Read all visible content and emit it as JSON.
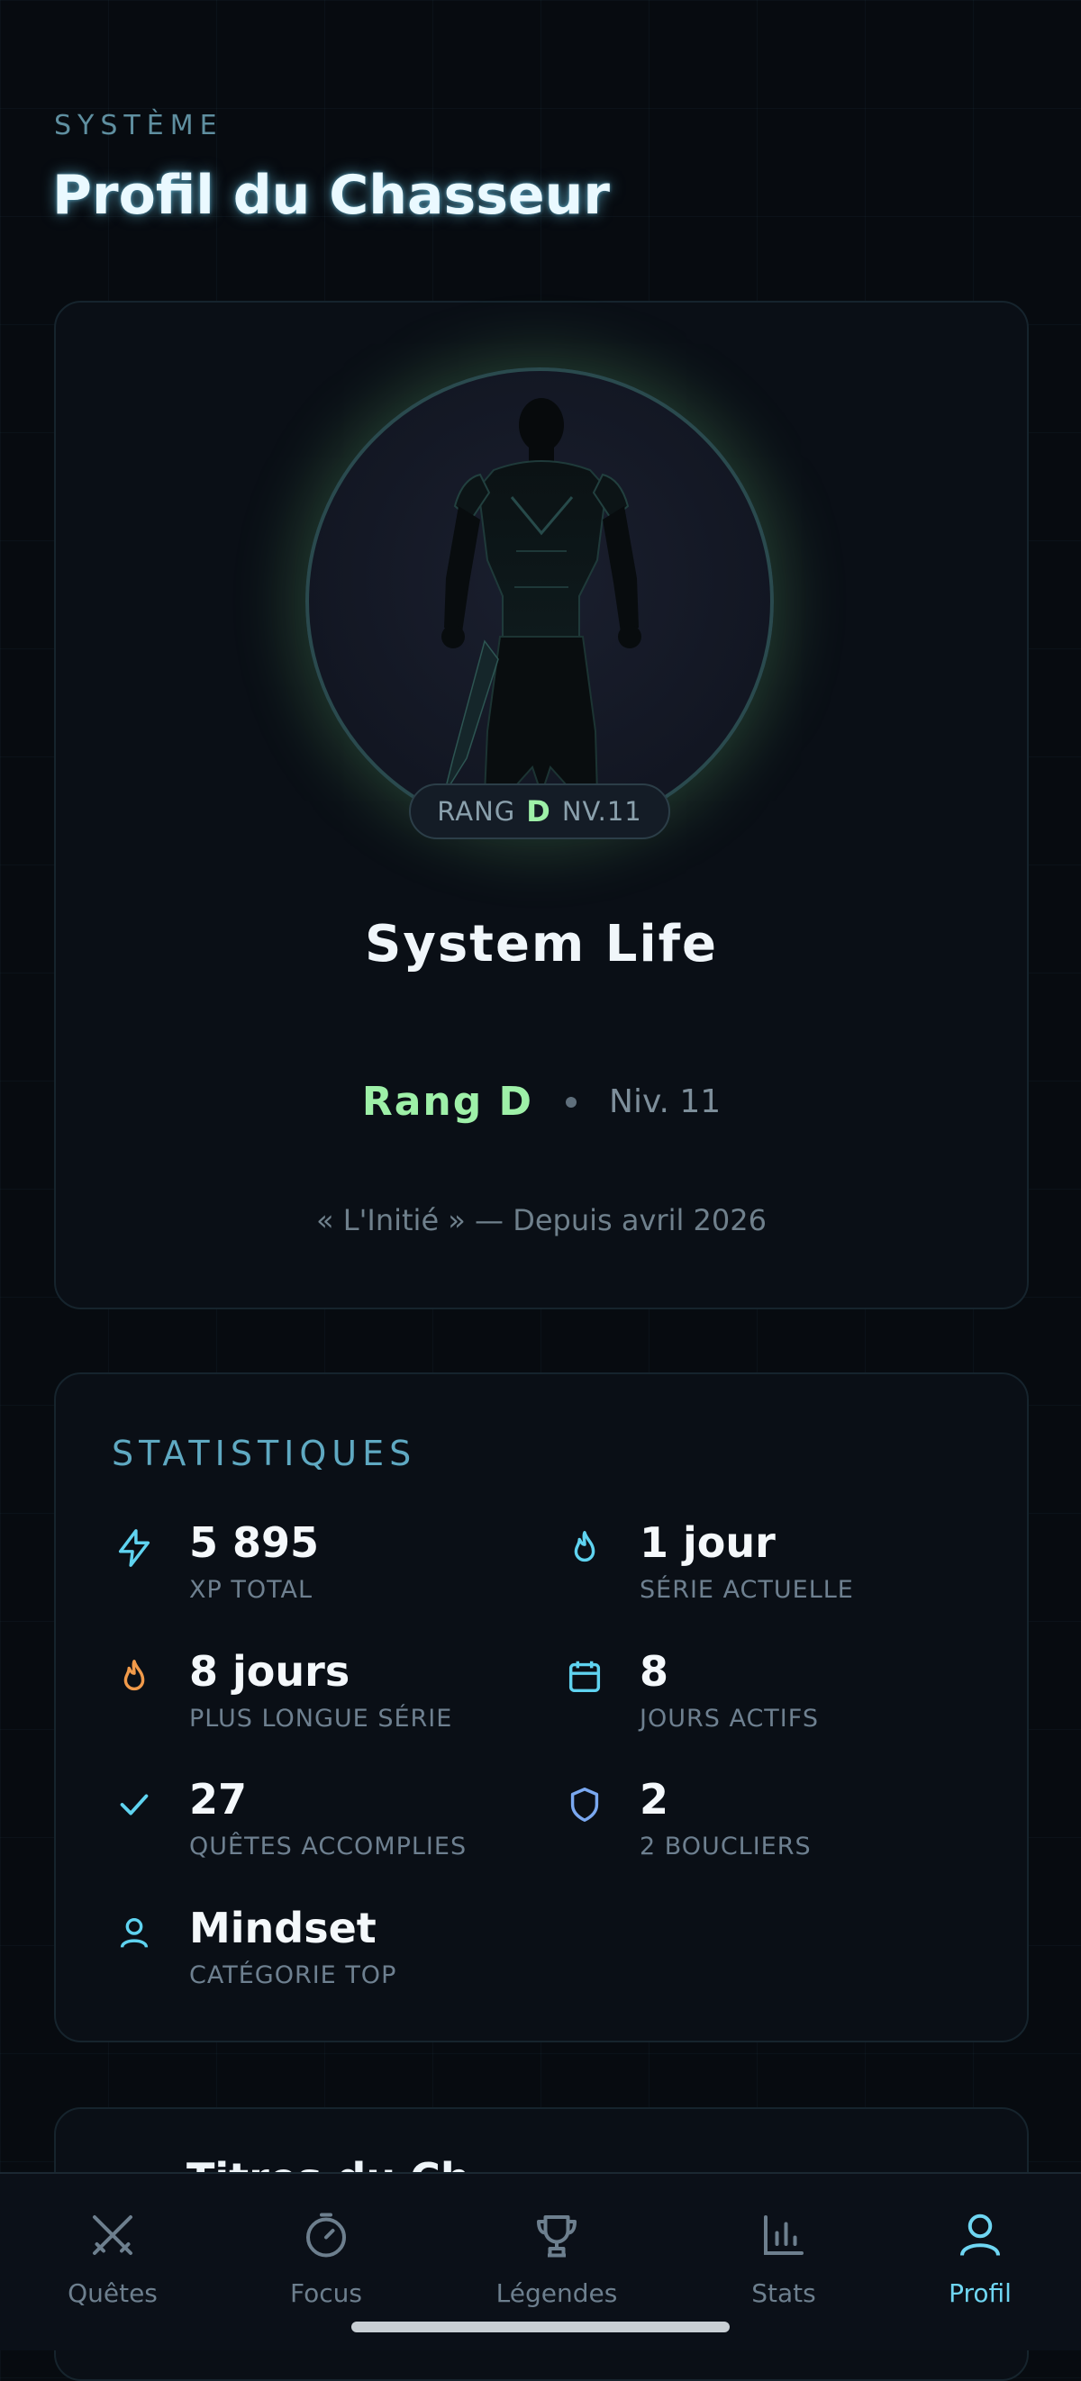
{
  "header": {
    "system_label": "SYSTÈME",
    "title": "Profil du Chasseur"
  },
  "profile": {
    "badge": {
      "rank_prefix": "RANG",
      "rank_letter": "D",
      "level": "NV.11"
    },
    "username": "System Life",
    "rank_text": "Rang D",
    "level_text": "Niv. 11",
    "since": "« L'Initié » — Depuis avril 2026",
    "colors": {
      "rank": "#9ef0a8",
      "glow": "#82e68c"
    }
  },
  "stats": {
    "title": "STATISTIQUES",
    "items": [
      {
        "icon": "lightning-icon",
        "value": "5 895",
        "label": "XP TOTAL"
      },
      {
        "icon": "flame-icon",
        "value": "1 jour",
        "label": "SÉRIE ACTUELLE"
      },
      {
        "icon": "flame-icon",
        "value": "8 jours",
        "label": "PLUS LONGUE SÉRIE"
      },
      {
        "icon": "calendar-icon",
        "value": "8",
        "label": "JOURS ACTIFS"
      },
      {
        "icon": "check-icon",
        "value": "27",
        "label": "QUÊTES ACCOMPLIES"
      },
      {
        "icon": "shield-icon",
        "value": "2",
        "label": "2 BOUCLIERS"
      },
      {
        "icon": "user-icon",
        "value": "Mindset",
        "label": "CATÉGORIE TOP"
      }
    ]
  },
  "peek": {
    "title": "Titres du Ch"
  },
  "nav": {
    "items": [
      {
        "label": "Quêtes",
        "icon": "crossed-swords-icon",
        "active": false
      },
      {
        "label": "Focus",
        "icon": "timer-icon",
        "active": false
      },
      {
        "label": "Légendes",
        "icon": "trophy-icon",
        "active": false
      },
      {
        "label": "Stats",
        "icon": "bar-chart-icon",
        "active": false
      },
      {
        "label": "Profil",
        "icon": "user-icon",
        "active": true
      }
    ],
    "active_color": "#6fd6f2",
    "inactive_color": "#6d7f8e"
  }
}
